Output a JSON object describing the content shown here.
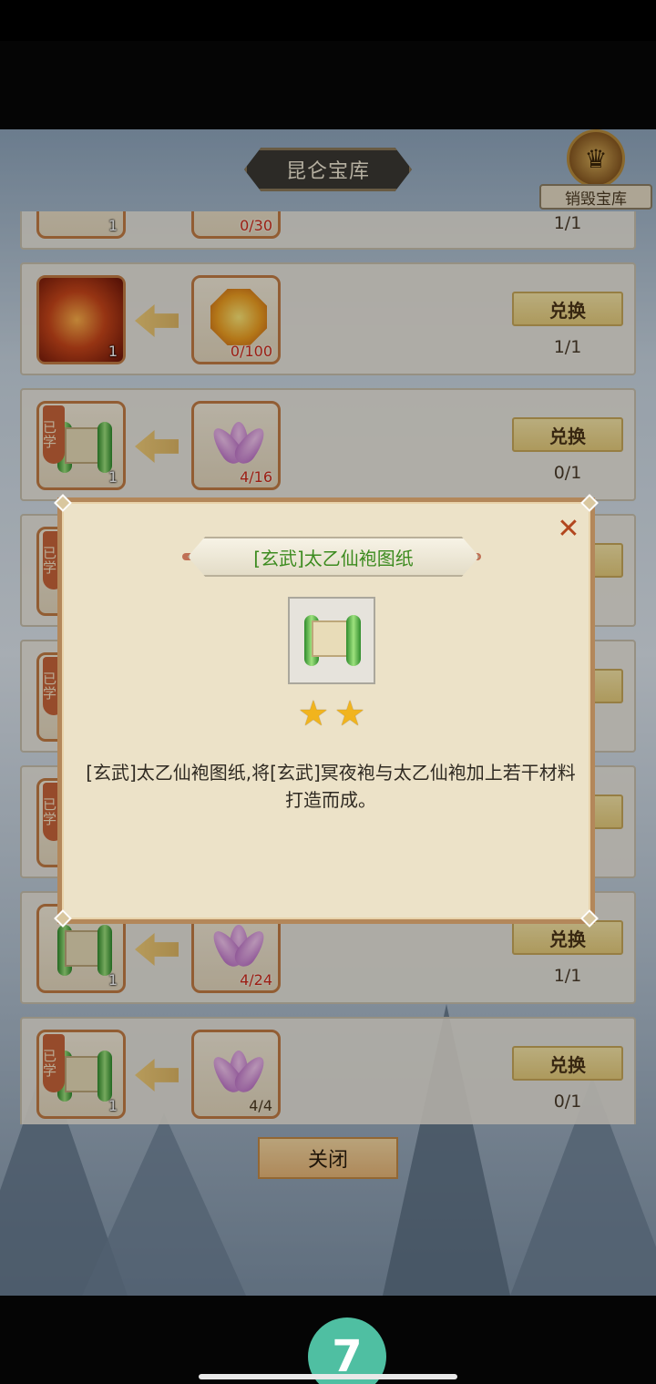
{
  "header": {
    "title": "昆仑宝库",
    "destroy_label": "销毁宝库"
  },
  "rows": [
    {
      "target": "item",
      "target_qty": "1",
      "cost_qty": "0/30",
      "count": "1/1",
      "button": ""
    },
    {
      "target": "dragon",
      "target_qty": "1",
      "cost_icon": "gem",
      "cost_qty": "0/100",
      "count": "1/1",
      "button": "兑换"
    },
    {
      "target": "scroll",
      "learned": "已学",
      "target_qty": "1",
      "cost_icon": "flower",
      "cost_qty": "4/16",
      "count": "0/1",
      "button": "兑换"
    },
    {
      "target": "scroll",
      "learned": "已学"
    },
    {
      "target": "scroll",
      "learned": "已学"
    },
    {
      "target": "scroll",
      "learned": "已学"
    },
    {
      "target": "scroll",
      "target_qty": "1",
      "cost_icon": "flower",
      "cost_qty": "4/24",
      "count": "1/1",
      "button": "兑换"
    },
    {
      "target": "scroll",
      "learned": "已学",
      "target_qty": "1",
      "cost_icon": "flower",
      "cost_qty": "4/4",
      "count": "0/1",
      "button": "兑换"
    }
  ],
  "footer": {
    "close_label": "关闭"
  },
  "dialog": {
    "title": "[玄武]太乙仙袍图纸",
    "stars": 2,
    "description": "[玄武]太乙仙袍图纸,将[玄武]冥夜袍与太乙仙袍加上若干材料打造而成。",
    "close_icon": "close-icon"
  },
  "bottom": {
    "badge": "7"
  }
}
